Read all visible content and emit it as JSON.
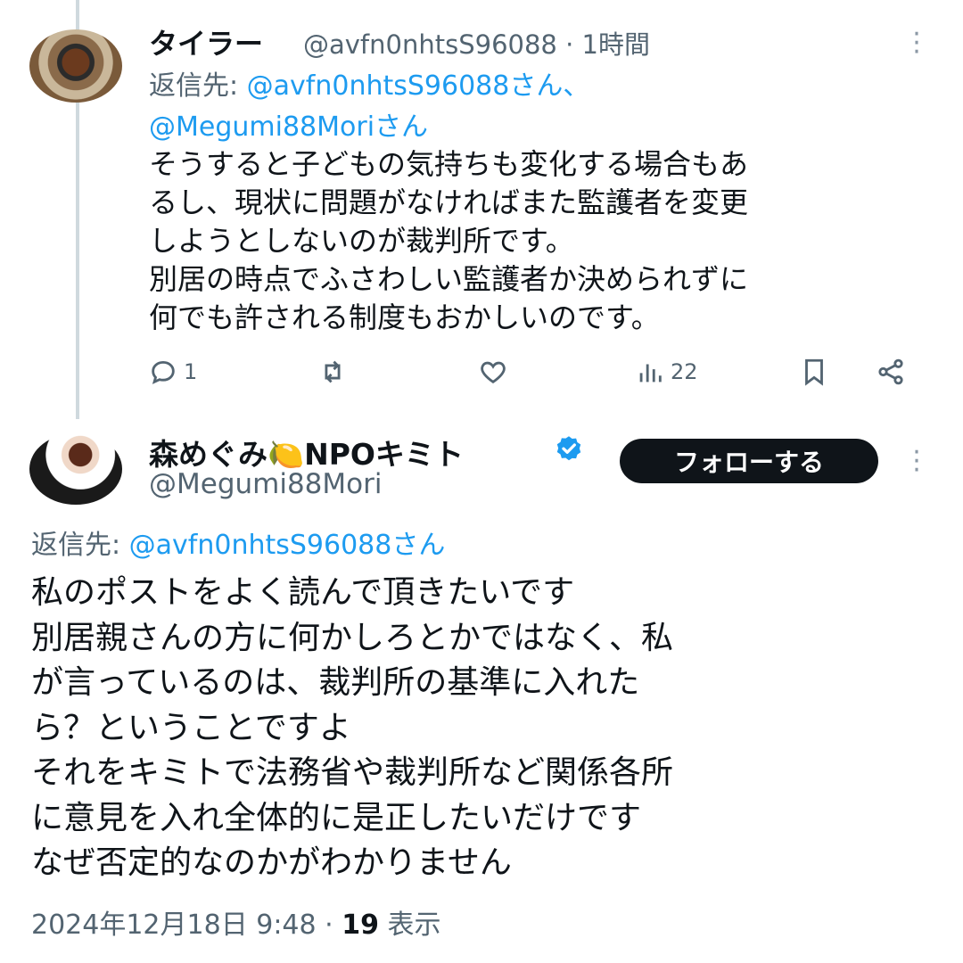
{
  "tweet1": {
    "author_name": "タイラー",
    "meta": "@avfn0nhtsS96088 · 1時間",
    "reply_prefix": "返信先: ",
    "reply_mention_a": "@avfn0nhtsS96088さん、",
    "reply_mention_b": "@Megumi88Moriさん",
    "body_lines": [
      "そうすると子どもの気持ちも変化する場合もあ",
      "るし、現状に問題がなければまた監護者を変更",
      "しようとしないのが裁判所です。",
      "別居の時点でふさわしい監護者か決められずに",
      "何でも許される制度もおかしいのです。"
    ],
    "actions": {
      "reply_count": "1",
      "retweet_count": "",
      "like_count": "",
      "views_count": "22"
    }
  },
  "tweet2": {
    "author_name": "森めぐみ🍋NPOキミト",
    "handle": "@Megumi88Mori",
    "follow_label": "フォローする",
    "reply_prefix": "返信先: ",
    "reply_mention": "@avfn0nhtsS96088さん",
    "body_lines": [
      "私のポストをよく読んで頂きたいです",
      "別居親さんの方に何かしろとかではなく、私",
      "が言っているのは、裁判所の基準に入れた",
      "ら？ということですよ",
      "それをキミトで法務省や裁判所など関係各所",
      "に意見を入れ全体的に是正したいだけです",
      "なぜ否定的なのかがわかりません"
    ],
    "timestamp": "2024年12月18日 9:48 · ",
    "views_number": "19",
    "views_label": " 表示"
  },
  "colors": {
    "text": "#0f1419",
    "secondary": "#536471",
    "link": "#1d9bf0",
    "verified": "#1d9bf0",
    "follow_bg": "#0f1419"
  },
  "icons": [
    "reply-icon",
    "retweet-icon",
    "like-icon",
    "views-icon",
    "bookmark-icon",
    "share-icon",
    "more-icon",
    "verified-badge-icon"
  ]
}
